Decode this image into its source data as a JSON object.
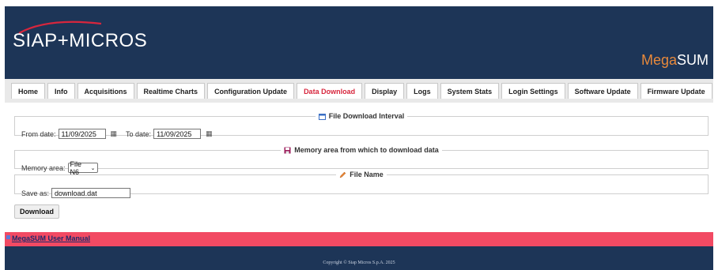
{
  "header": {
    "logo_text": "SIAP+MICROS",
    "brand_mega": "Mega",
    "brand_sum": "SUM"
  },
  "tabs": [
    {
      "label": "Home",
      "active": false
    },
    {
      "label": "Info",
      "active": false
    },
    {
      "label": "Acquisitions",
      "active": false
    },
    {
      "label": "Realtime Charts",
      "active": false
    },
    {
      "label": "Configuration Update",
      "active": false
    },
    {
      "label": "Data Download",
      "active": true
    },
    {
      "label": "Display",
      "active": false
    },
    {
      "label": "Logs",
      "active": false
    },
    {
      "label": "System Stats",
      "active": false
    },
    {
      "label": "Login Settings",
      "active": false
    },
    {
      "label": "Software Update",
      "active": false
    },
    {
      "label": "Firmware Update",
      "active": false
    }
  ],
  "interval": {
    "legend": "File Download Interval",
    "from_label": "From date:",
    "from_value": "11/09/2025",
    "to_label": "To date:",
    "to_value": "11/09/2025"
  },
  "memory": {
    "legend": "Memory area from which to download data",
    "label": "Memory area:",
    "selected": "File N6"
  },
  "filename": {
    "legend": "File Name",
    "label": "Save as:",
    "value": "download.dat"
  },
  "download_button": "Download",
  "manual_link": "MegaSUM User Manual",
  "footer": {
    "copyright": "Copyright © Siap Micros S.p.A. 2025"
  },
  "colors": {
    "header_bg": "#1d3557",
    "active_tab": "#d7263d",
    "brand_accent": "#e8893b",
    "red_bar": "#f24a63"
  }
}
